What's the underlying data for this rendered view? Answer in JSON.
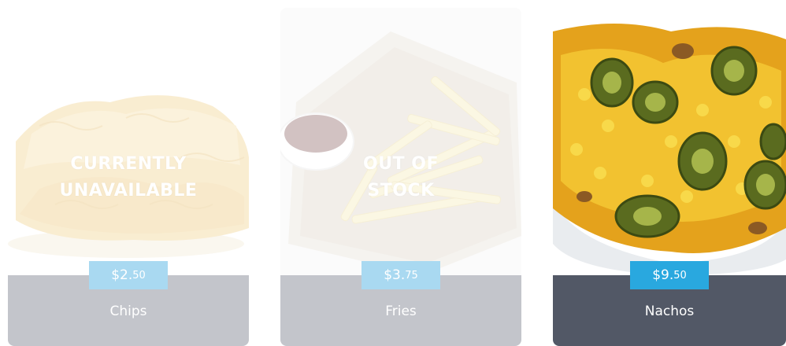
{
  "products": [
    {
      "name": "Chips",
      "price_main": "$2.",
      "price_cents": "50",
      "status_line1": "CURRENTLY",
      "status_line2": "UNAVAILABLE",
      "image_icon": "chips-image"
    },
    {
      "name": "Fries",
      "price_main": "$3.",
      "price_cents": "75",
      "status_line1": "OUT OF",
      "status_line2": "STOCK",
      "image_icon": "fries-image"
    },
    {
      "name": "Nachos",
      "price_main": "$9.",
      "price_cents": "50",
      "image_icon": "nachos-image"
    }
  ],
  "colors": {
    "price_badge": "#29a8df",
    "price_badge_muted": "#9bd3ef",
    "footer": "#525866",
    "footer_muted": "#b9bcc3"
  }
}
